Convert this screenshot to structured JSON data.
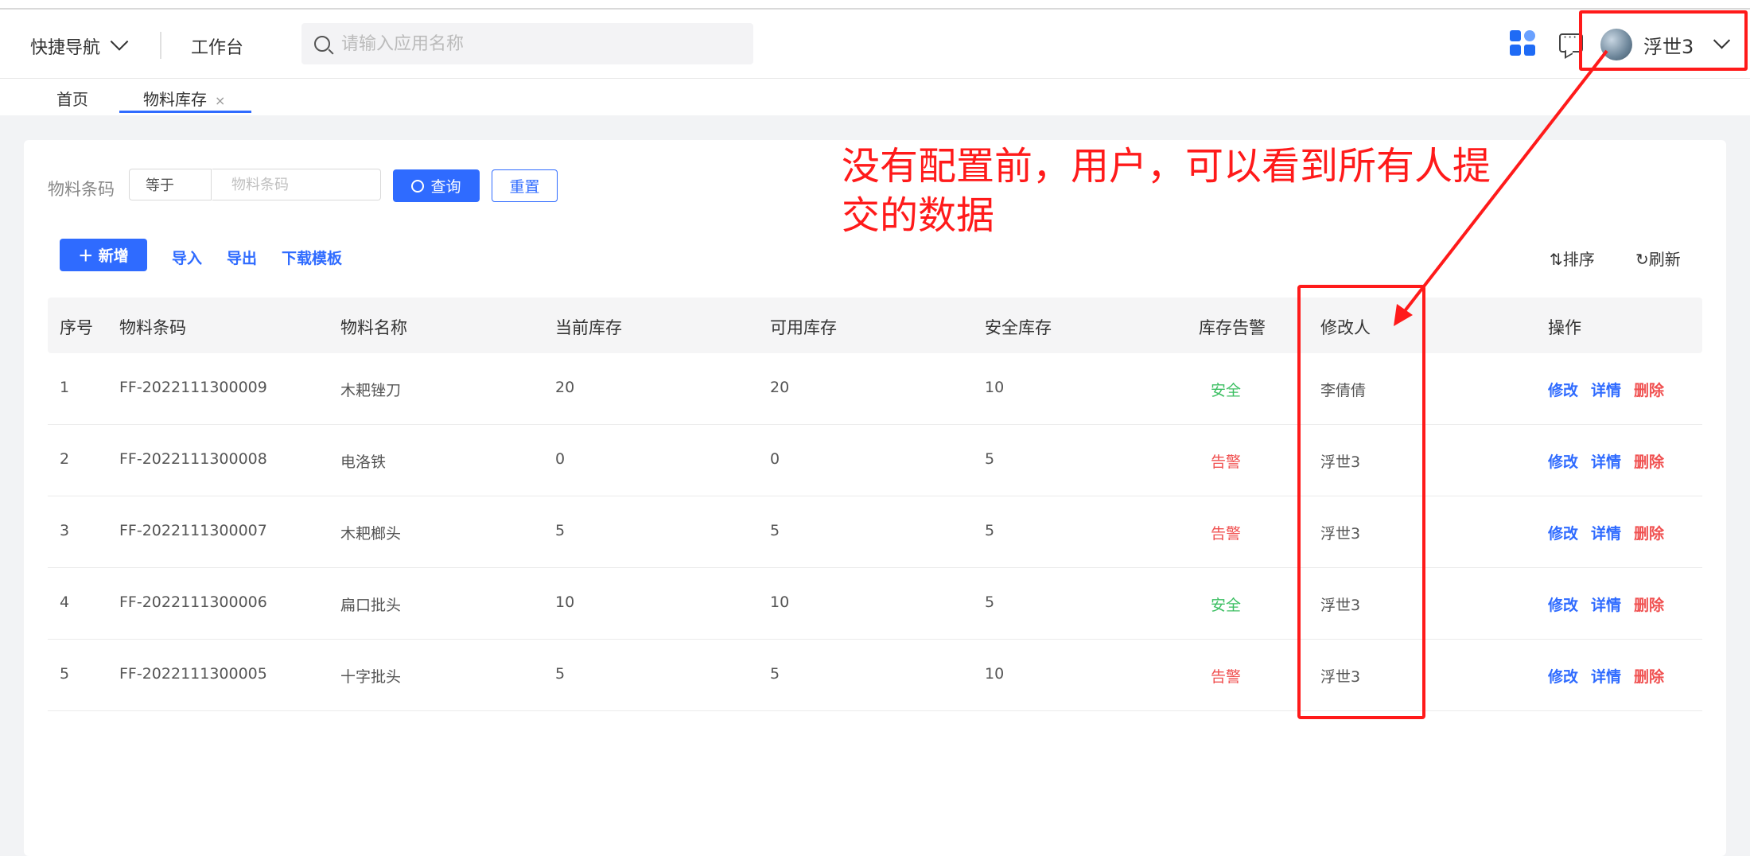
{
  "header": {
    "quick_nav": "快捷导航",
    "workbench": "工作台",
    "search_placeholder": "请输入应用名称",
    "user_name": "浮世3"
  },
  "tabs": [
    {
      "label": "首页"
    },
    {
      "label": "物料库存",
      "close": "×"
    }
  ],
  "filter": {
    "label": "物料条码",
    "operator": "等于",
    "placeholder": "物料条码",
    "query": "查询",
    "reset": "重置"
  },
  "toolbar": {
    "add": "＋ 新增",
    "import": "导入",
    "export": "导出",
    "download_template": "下载模板",
    "sort": "排序",
    "refresh": "刷新"
  },
  "annotation": "没有配置前，用户，可以看到所有人提交的数据",
  "table": {
    "columns": [
      "序号",
      "物料条码",
      "物料名称",
      "当前库存",
      "可用库存",
      "安全库存",
      "库存告警",
      "修改人",
      "操作"
    ],
    "actions": [
      "修改",
      "详情",
      "删除"
    ],
    "rows": [
      [
        "1",
        "FF-2022111300009",
        "木耙锉刀",
        "20",
        "20",
        "10",
        "安全",
        "李倩倩"
      ],
      [
        "2",
        "FF-2022111300008",
        "电洛铁",
        "0",
        "0",
        "5",
        "告警",
        "浮世3"
      ],
      [
        "3",
        "FF-2022111300007",
        "木耙榔头",
        "5",
        "5",
        "5",
        "告警",
        "浮世3"
      ],
      [
        "4",
        "FF-2022111300006",
        "扁口批头",
        "10",
        "10",
        "5",
        "安全",
        "浮世3"
      ],
      [
        "5",
        "FF-2022111300005",
        "十字批头",
        "5",
        "5",
        "10",
        "告警",
        "浮世3"
      ]
    ]
  },
  "colors": {
    "primary": "#2f6bff",
    "safe": "#3cbf62",
    "warning": "#f05050",
    "annotation": "#ff1a1a"
  }
}
